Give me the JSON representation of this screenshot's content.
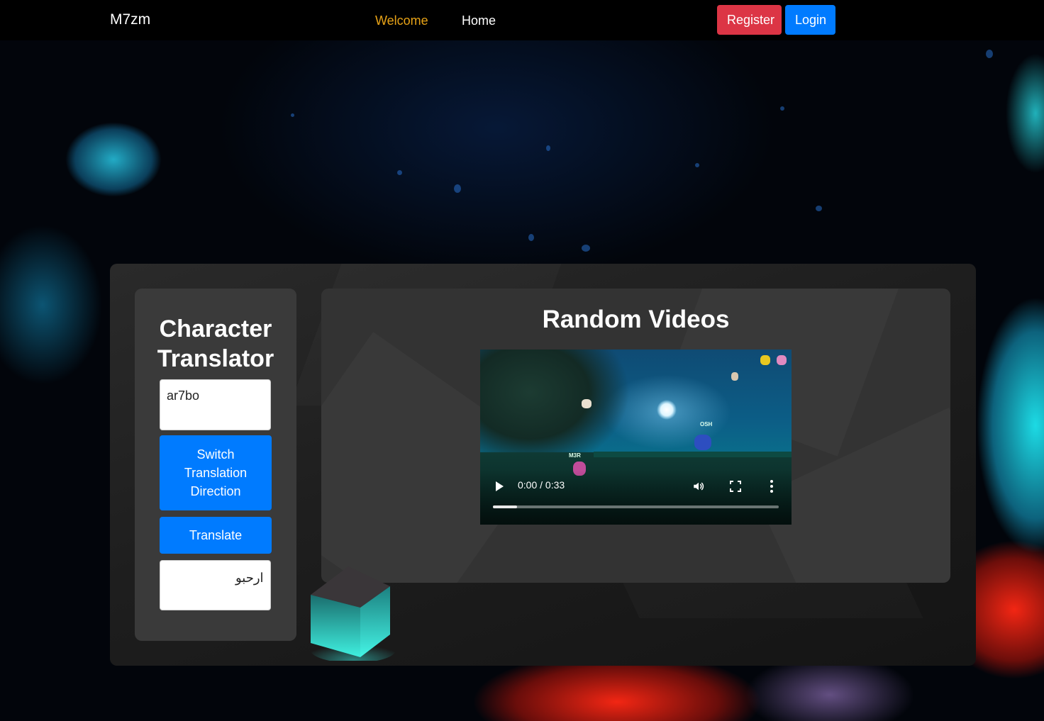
{
  "nav": {
    "brand": "M7zm",
    "links": [
      {
        "label": "Welcome",
        "active": true
      },
      {
        "label": "Home",
        "active": false
      }
    ],
    "register_label": "Register",
    "login_label": "Login"
  },
  "translator": {
    "title": "Character Translator",
    "input_value": "ar7bo",
    "switch_label": "Switch Translation Direction",
    "translate_label": "Translate",
    "output_value": "ارحبو"
  },
  "videos": {
    "title": "Random Videos",
    "player": {
      "time_display": "0:00 / 0:33",
      "played_fraction": 0.0,
      "buffered_fraction": 0.085,
      "overlay_labels": [
        "OSH",
        "M3R"
      ]
    }
  },
  "colors": {
    "accent_active": "#e8a317",
    "register": "#dc3545",
    "primary": "#007bff"
  }
}
